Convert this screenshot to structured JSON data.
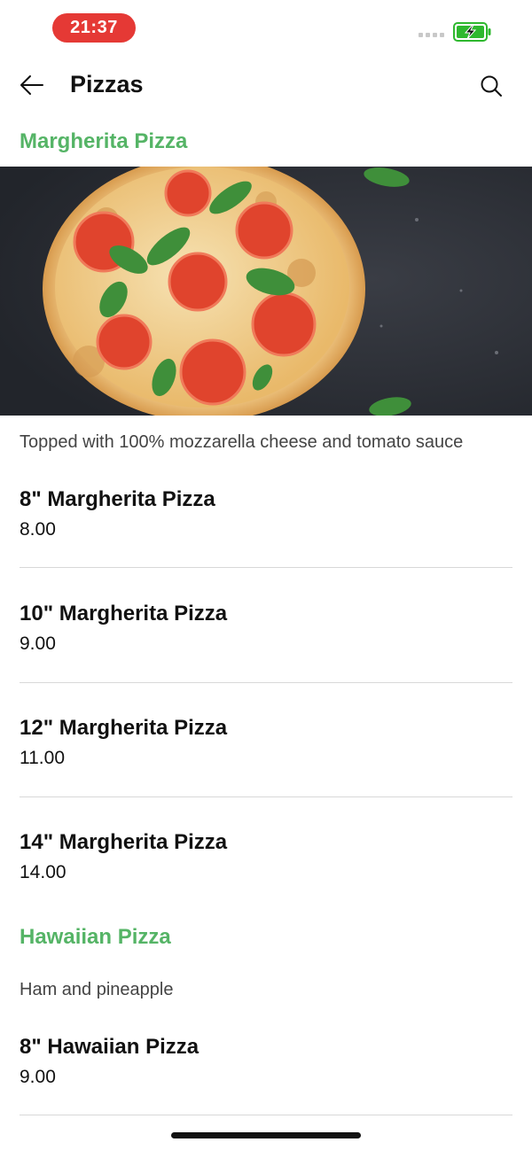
{
  "status_bar": {
    "time": "21:37",
    "battery_color": "#2eb82e",
    "time_pill_color": "#e53935"
  },
  "header": {
    "title": "Pizzas",
    "back_icon": "arrow-left-icon",
    "search_icon": "search-icon"
  },
  "accent_color": "#55b466",
  "sections": [
    {
      "title": "Margherita Pizza",
      "description": "Topped with 100% mozzarella cheese and tomato sauce",
      "items": [
        {
          "name": "8\" Margherita Pizza",
          "price": "8.00"
        },
        {
          "name": "10\" Margherita Pizza",
          "price": "9.00"
        },
        {
          "name": "12\" Margherita Pizza",
          "price": "11.00"
        },
        {
          "name": "14\" Margherita Pizza",
          "price": "14.00"
        }
      ]
    },
    {
      "title": "Hawaiian Pizza",
      "description": "Ham and pineapple",
      "items": [
        {
          "name": "8\" Hawaiian Pizza",
          "price": "9.00"
        }
      ]
    }
  ]
}
